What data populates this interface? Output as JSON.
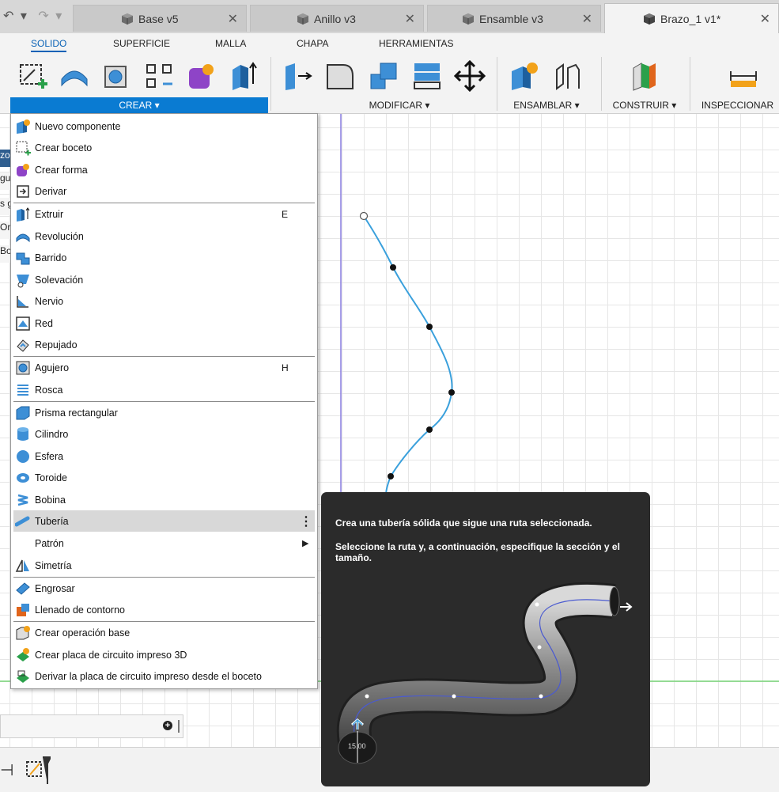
{
  "tabs": [
    {
      "label": "Base v5",
      "close": "✕"
    },
    {
      "label": "Anillo v3",
      "close": "✕"
    },
    {
      "label": "Ensamble v3",
      "close": "✕"
    },
    {
      "label": "Brazo_1 v1*",
      "close": "✕"
    }
  ],
  "nav": {
    "back": "↶ ▾",
    "forward": "↷ ▾"
  },
  "ribbon_tabs": [
    "SOLIDO",
    "SUPERFICIE",
    "MALLA",
    "CHAPA",
    "HERRAMIENTAS"
  ],
  "groups": {
    "crear": "CREAR ▾",
    "modificar": "MODIFICAR ▾",
    "ensamblar": "ENSAMBLAR ▾",
    "construir": "CONSTRUIR ▾",
    "inspeccionar": "INSPECCIONAR"
  },
  "menu": {
    "items": [
      {
        "label": "Nuevo componente"
      },
      {
        "label": "Crear boceto"
      },
      {
        "label": "Crear forma"
      },
      {
        "label": "Derivar"
      },
      {
        "label": "Extruir",
        "shortcut": "E"
      },
      {
        "label": "Revolución"
      },
      {
        "label": "Barrido"
      },
      {
        "label": "Solevación"
      },
      {
        "label": "Nervio"
      },
      {
        "label": "Red"
      },
      {
        "label": "Repujado"
      },
      {
        "label": "Agujero",
        "shortcut": "H"
      },
      {
        "label": "Rosca"
      },
      {
        "label": "Prisma rectangular"
      },
      {
        "label": "Cilindro"
      },
      {
        "label": "Esfera"
      },
      {
        "label": "Toroide"
      },
      {
        "label": "Bobina"
      },
      {
        "label": "Tubería",
        "more": "⋮"
      },
      {
        "label": "Patrón",
        "arrow": "▶"
      },
      {
        "label": "Simetría"
      },
      {
        "label": "Engrosar"
      },
      {
        "label": "Llenado de contorno"
      },
      {
        "label": "Crear operación base"
      },
      {
        "label": "Crear placa de circuito impreso 3D"
      },
      {
        "label": "Derivar la placa de circuito impreso desde el boceto"
      }
    ]
  },
  "left_peek": [
    "zo",
    "gu",
    "s g",
    "Or",
    "Bo"
  ],
  "tooltip": {
    "title": "Crea una tubería sólida que sigue una ruta seleccionada.",
    "body": "Seleccione la ruta y, a continuación, especifique la sección y el tamaño.",
    "dimension": "15.00"
  },
  "colors": {
    "accent": "#0a7bd2",
    "sketch_curve": "#3aa0dc",
    "tooltip_bg": "#2b2b2b",
    "menu_highlight": "#d8d8d8"
  }
}
